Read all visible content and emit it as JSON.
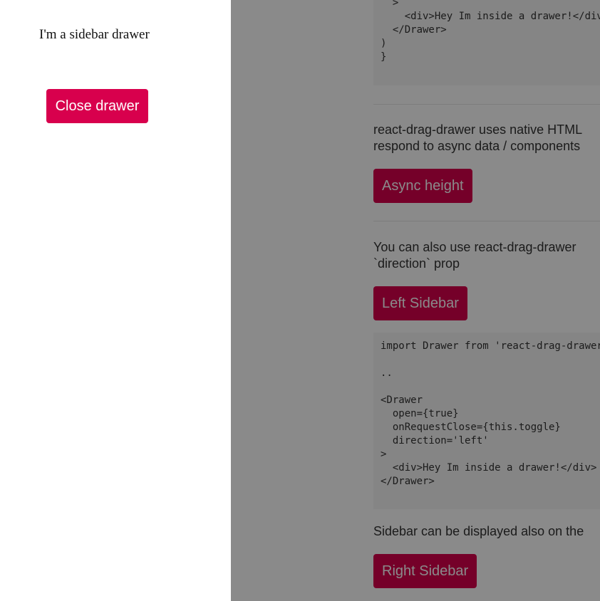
{
  "drawer": {
    "text": "I'm a sidebar drawer",
    "close_button": "Close drawer"
  },
  "code_top": {
    "lines": [
      "  >",
      "    <div>Hey Im inside a drawer!</div>",
      "  </Drawer>",
      ")",
      "}"
    ]
  },
  "async_section": {
    "line1": "react-drag-drawer uses native HTML",
    "line2": "respond to async data / components",
    "button": "Async height"
  },
  "left_section": {
    "line1": "You can also use react-drag-drawer",
    "line2": "`direction` prop",
    "button": "Left Sidebar"
  },
  "code_bottom": {
    "lines": [
      "import Drawer from 'react-drag-drawer'",
      "",
      "..",
      "",
      "<Drawer",
      "  open={true}",
      "  onRequestClose={this.toggle}",
      "  direction='left'",
      ">",
      "  <div>Hey Im inside a drawer!</div>",
      "</Drawer>"
    ]
  },
  "right_section": {
    "line1": "Sidebar can be displayed also on the",
    "button": "Right Sidebar"
  },
  "colors": {
    "accent": "#d8004d",
    "overlay": "rgba(0,0,0,0.46)"
  }
}
